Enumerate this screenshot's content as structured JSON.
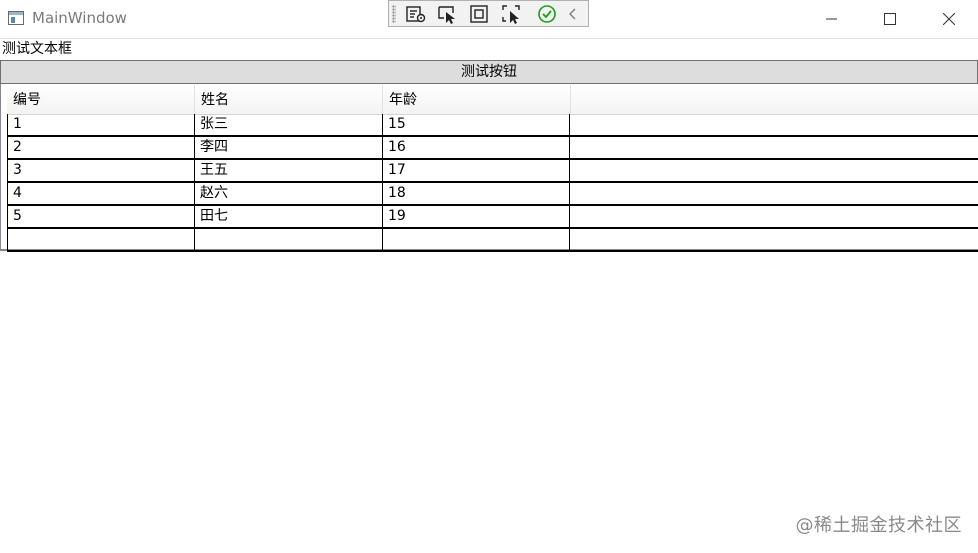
{
  "window": {
    "title": "MainWindow"
  },
  "textbox": {
    "label": "测试文本框"
  },
  "button": {
    "label": "测试按钮"
  },
  "table": {
    "columns": [
      "编号",
      "姓名",
      "年龄"
    ],
    "rows": [
      [
        "1",
        "张三",
        "15"
      ],
      [
        "2",
        "李四",
        "16"
      ],
      [
        "3",
        "王五",
        "17"
      ],
      [
        "4",
        "赵六",
        "18"
      ],
      [
        "5",
        "田七",
        "19"
      ],
      [
        "",
        "",
        ""
      ]
    ]
  },
  "watermark": "@稀土掘金技术社区",
  "colors": {
    "button_bg": "#dddddd",
    "grid_border": "#828790",
    "toolbar_check": "#1a9e1a"
  },
  "icons": {
    "toolbar": [
      "live-visual-tree-icon",
      "select-element-icon",
      "display-layout-adorners-icon",
      "track-focused-element-icon",
      "binding-failures-check-icon",
      "collapse-chevron-icon"
    ],
    "caption": [
      "minimize-icon",
      "maximize-icon",
      "close-icon"
    ]
  }
}
